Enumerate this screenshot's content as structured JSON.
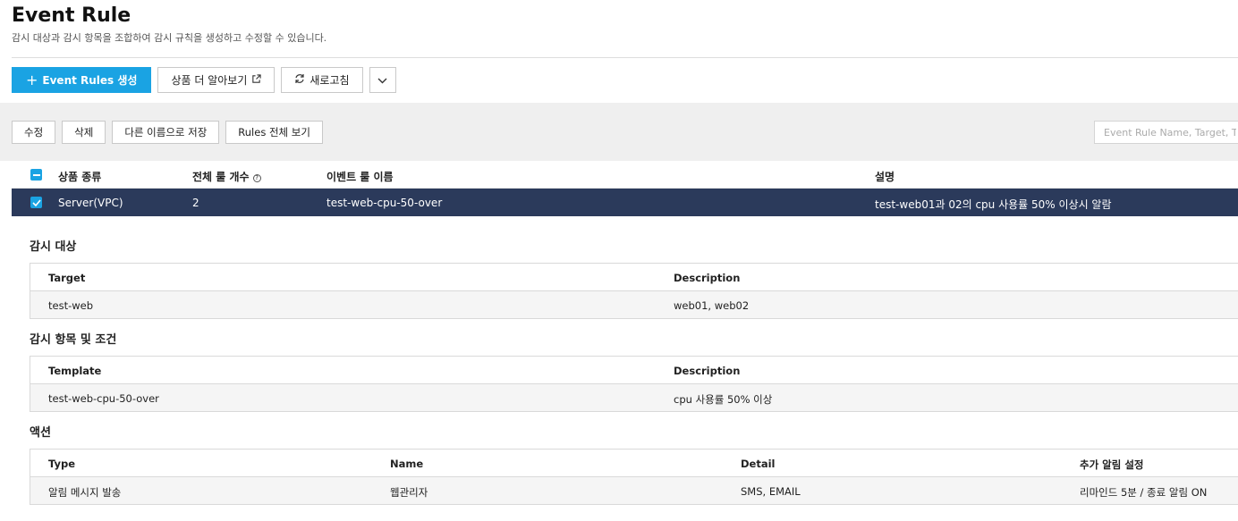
{
  "header": {
    "title": "Event Rule",
    "description": "감시 대상과 감시 항목을 조합하여 감시 규칙을 생성하고 수정할 수 있습니다."
  },
  "toolbar": {
    "create_label": "Event Rules 생성",
    "learn_more_label": "상품 더 알아보기",
    "refresh_label": "새로고침"
  },
  "actions": {
    "edit": "수정",
    "delete": "삭제",
    "save_as": "다른 이름으로 저장",
    "view_all": "Rules 전체 보기"
  },
  "search": {
    "placeholder": "Event Rule Name, Target, Template"
  },
  "rules_table": {
    "columns": [
      "상품 종류",
      "전체 룰 개수",
      "이벤트 룰 이름",
      "설명"
    ],
    "rows": [
      {
        "product": "Server(VPC)",
        "count": "2",
        "name": "test-web-cpu-50-over",
        "description": "test-web01과 02의 cpu 사용률 50% 이상시 알람"
      }
    ]
  },
  "target_section": {
    "title": "감시 대상",
    "columns": [
      "Target",
      "Description"
    ],
    "rows": [
      {
        "target": "test-web",
        "description": "web01, web02"
      }
    ]
  },
  "condition_section": {
    "title": "감시 항목 및 조건",
    "columns": [
      "Template",
      "Description"
    ],
    "rows": [
      {
        "template": "test-web-cpu-50-over",
        "description": "cpu 사용률 50% 이상"
      }
    ]
  },
  "action_section": {
    "title": "액션",
    "columns": [
      "Type",
      "Name",
      "Detail",
      "추가 알림 설정"
    ],
    "rows": [
      {
        "type": "알림 메시지 발송",
        "name": "웹관리자",
        "detail": "SMS, EMAIL",
        "extra": "리마인드 5분 / 종료 알림 ON"
      }
    ]
  },
  "colors": {
    "primary": "#1aa3e3",
    "selected_row": "#2b3a5b",
    "toolbar_bg": "#efefef"
  }
}
